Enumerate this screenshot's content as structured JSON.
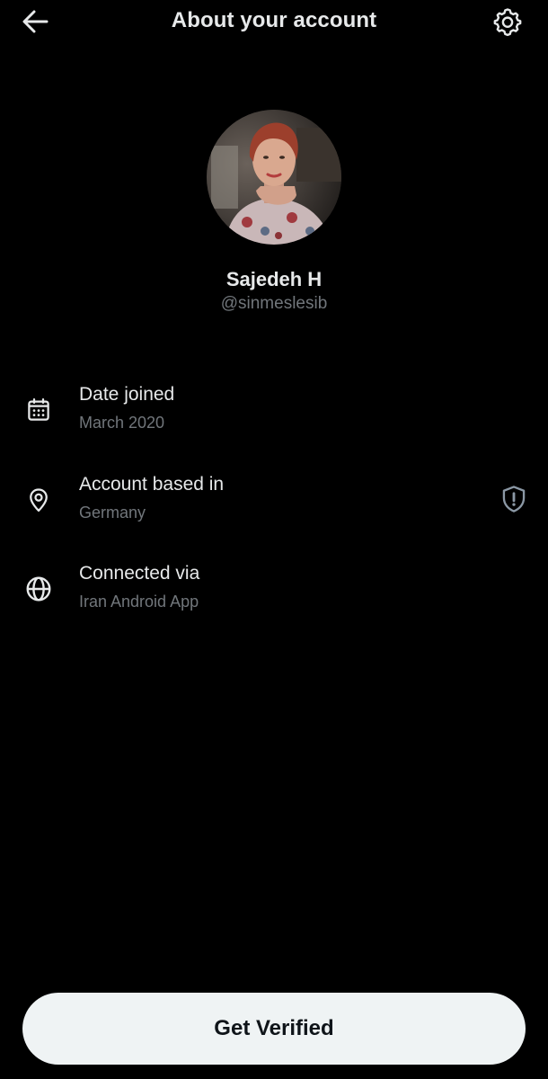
{
  "header": {
    "title": "About your account",
    "back_icon": "arrow-left-icon",
    "settings_icon": "gear-icon"
  },
  "profile": {
    "display_name": "Sajedeh H",
    "handle": "@sinmeslesib"
  },
  "info_rows": [
    {
      "icon": "calendar-icon",
      "label": "Date joined",
      "value": "March 2020"
    },
    {
      "icon": "location-pin-icon",
      "label": "Account based in",
      "value": "Germany",
      "extra_icon": "shield-alert-icon"
    },
    {
      "icon": "globe-icon",
      "label": "Connected via",
      "value": "Iran Android App"
    }
  ],
  "cta": {
    "label": "Get Verified"
  },
  "colors": {
    "background": "#000000",
    "primary_text": "#e7e9ea",
    "secondary_text": "#71767b",
    "button_bg": "#eff3f4",
    "button_text": "#0f1419"
  }
}
